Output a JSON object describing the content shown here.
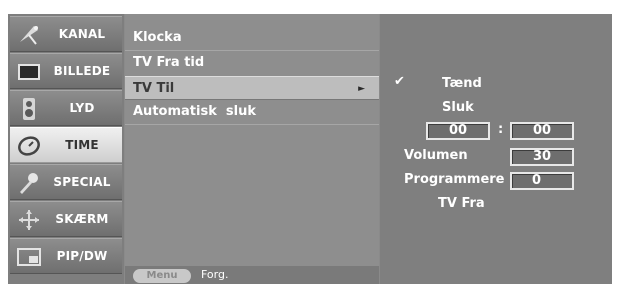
{
  "sidebar": {
    "items": [
      {
        "label": "KANAL"
      },
      {
        "label": "BILLEDE"
      },
      {
        "label": "LYD"
      },
      {
        "label": "TIME"
      },
      {
        "label": "SPECIAL"
      },
      {
        "label": "SKÆRM"
      },
      {
        "label": "PIP/DW"
      }
    ],
    "selected": "TIME"
  },
  "menu": {
    "items": [
      {
        "label": "Klocka"
      },
      {
        "label": "TV Fra tid"
      },
      {
        "label": "TV Til"
      },
      {
        "label": "Automatisk  sluk"
      }
    ],
    "selected": "TV Til",
    "selected_arrow": "►"
  },
  "footer": {
    "menu_button": "Menu",
    "prev_label": "Forg."
  },
  "panel": {
    "check_mark": "✔",
    "on_label": "Tænd",
    "off_label": "Sluk",
    "hour": "00",
    "time_sep": ":",
    "minute": "00",
    "volume_label": "Volumen",
    "volume_value": "30",
    "programme_label": "Programmere",
    "programme_value": "0",
    "tv_off_label": "TV Fra"
  },
  "colors": {
    "osd_background": "#8a8a8a",
    "selected_background": "#d8d8d8",
    "text": "#ffffff"
  }
}
